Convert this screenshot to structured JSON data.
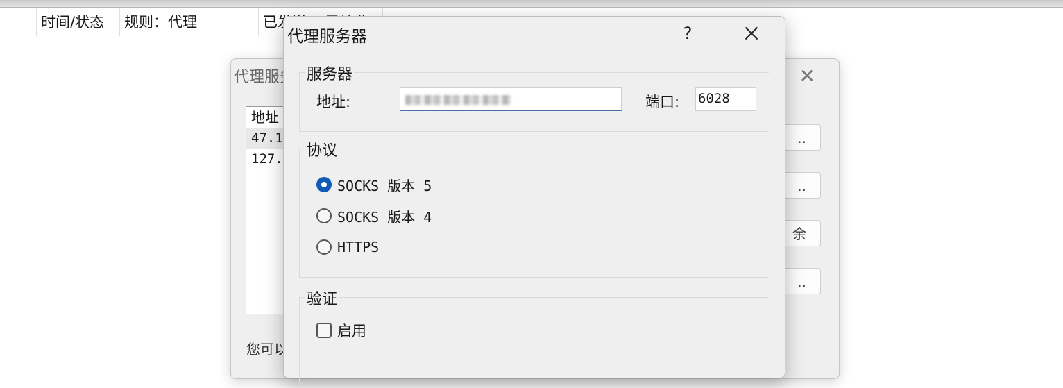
{
  "background_list": {
    "headers": [
      "时间/状态",
      "规则：代理",
      "已发送",
      "已接收"
    ]
  },
  "background_dialog": {
    "title": "代理服务器",
    "list_header": "地址",
    "rows": [
      "47.1",
      "127."
    ],
    "buttons": [
      "..",
      "..",
      "余",
      ".."
    ],
    "footer_text": "您可以"
  },
  "dialog": {
    "title": "代理服务器",
    "help": "?",
    "server": {
      "legend": "服务器",
      "address_label": "地址:",
      "address_value": "",
      "port_label": "端口:",
      "port_value": "6028"
    },
    "protocol": {
      "legend": "协议",
      "options": [
        {
          "label": "SOCKS 版本 5",
          "selected": true
        },
        {
          "label": "SOCKS 版本 4",
          "selected": false
        },
        {
          "label": "HTTPS",
          "selected": false
        }
      ]
    },
    "auth": {
      "legend": "验证",
      "enable_label": "启用",
      "enabled": false
    }
  }
}
